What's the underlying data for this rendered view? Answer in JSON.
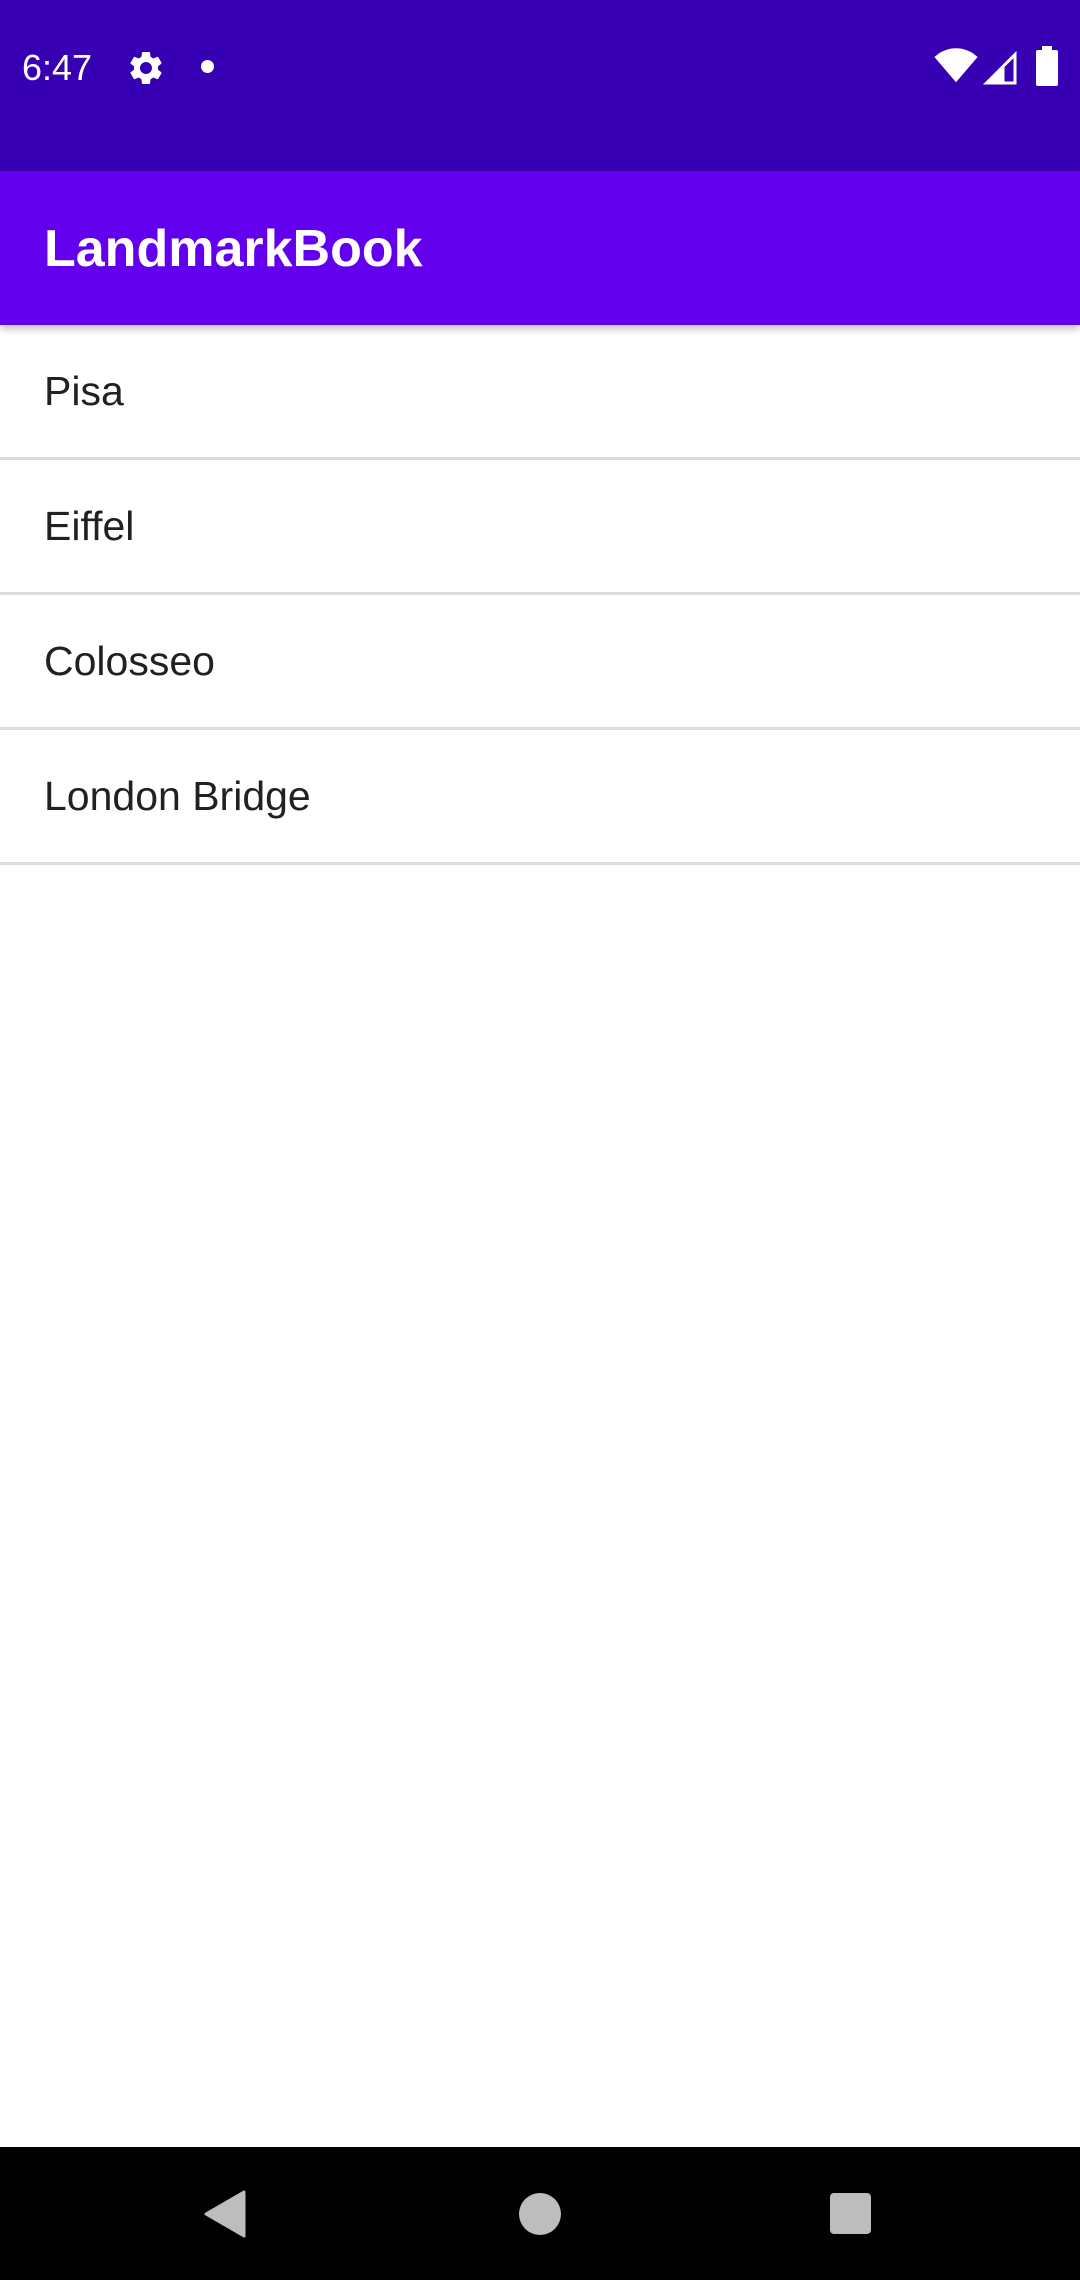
{
  "status_bar": {
    "time": "6:47",
    "icons": [
      "gear-icon",
      "notification-dot-icon",
      "wifi-icon",
      "cellular-signal-icon",
      "battery-icon"
    ],
    "background_color": "#3700b3"
  },
  "app_bar": {
    "title": "LandmarkBook",
    "background_color": "#6200ee"
  },
  "landmarks": [
    {
      "name": "Pisa"
    },
    {
      "name": "Eiffel"
    },
    {
      "name": "Colosseo"
    },
    {
      "name": "London Bridge"
    }
  ],
  "nav_bar": {
    "icons": [
      "back-icon",
      "home-icon",
      "recents-icon"
    ]
  }
}
